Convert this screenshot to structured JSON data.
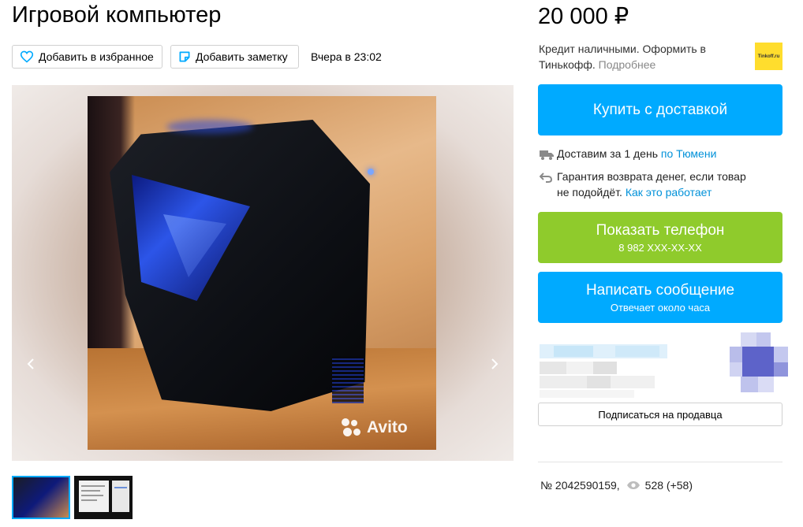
{
  "listing": {
    "title": "Игровой компьютер",
    "add_favorite_label": "Добавить в избранное",
    "add_note_label": "Добавить заметку",
    "posted_date": "Вчера в 23:02",
    "watermark": "Avito"
  },
  "sidebar": {
    "price": "20 000 ₽",
    "credit_text": "Кредит наличными. Оформить в Тинькофф.",
    "credit_more": "Подробнее",
    "tinkoff_logo_text": "Tinkoff.ru",
    "buy_delivery_label": "Купить с доставкой",
    "delivery_text": "Доставим за 1 день",
    "delivery_link": "по Тюмени",
    "guarantee_text": "Гарантия возврата денег, если товар не подойдёт.",
    "guarantee_link": "Как это работает",
    "show_phone_label": "Показать телефон",
    "phone_masked": "8 982 XXX-XX-XX",
    "message_label": "Написать сообщение",
    "message_sub": "Отвечает около часа",
    "subscribe_label": "Подписаться на продавца",
    "ad_number": "№ 2042590159,",
    "views": "528 (+58)"
  },
  "colors": {
    "primary_blue": "#00aaff",
    "phone_green": "#8fcb2c",
    "link_blue": "#0091d9",
    "tinkoff_yellow": "#ffdd2d"
  },
  "icons": {
    "favorite": "heart-outline-icon",
    "note": "note-icon",
    "delivery": "truck-icon",
    "guarantee": "return-arrow-icon",
    "views": "eye-icon",
    "prev": "chevron-left-icon",
    "next": "chevron-right-icon"
  }
}
